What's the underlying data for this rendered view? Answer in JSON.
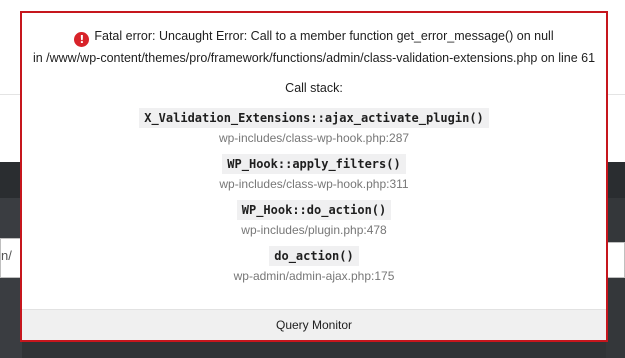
{
  "error": {
    "line1": "Fatal error: Uncaught Error: Call to a member function get_error_message() on null",
    "line2": "in /www/wp-content/themes/pro/framework/functions/admin/class-validation-extensions.php on line 61",
    "icon": "error-circle-icon",
    "icon_glyph": "!",
    "icon_color": "#d8232a",
    "border_color": "#c6161d"
  },
  "stack": {
    "title": "Call stack:",
    "frames": [
      {
        "function": "X_Validation_Extensions::ajax_activate_plugin()",
        "file": "wp-includes/class-wp-hook.php:287"
      },
      {
        "function": "WP_Hook::apply_filters()",
        "file": "wp-includes/class-wp-hook.php:311"
      },
      {
        "function": "WP_Hook::do_action()",
        "file": "wp-includes/plugin.php:478"
      },
      {
        "function": "do_action()",
        "file": "wp-admin/admin-ajax.php:175"
      }
    ]
  },
  "footer": {
    "label": "Query Monitor"
  },
  "background": {
    "left_input_char": "n/"
  }
}
